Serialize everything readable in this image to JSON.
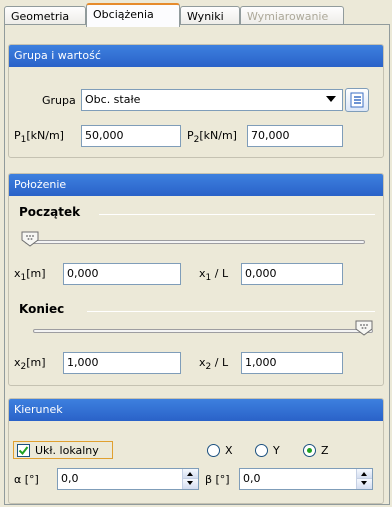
{
  "tabs": [
    {
      "label": "Geometria",
      "state": "normal"
    },
    {
      "label": "Obciążenia",
      "state": "active"
    },
    {
      "label": "Wyniki",
      "state": "normal"
    },
    {
      "label": "Wymiarowanie",
      "state": "disabled"
    }
  ],
  "group_value": {
    "header": "Grupa i wartość",
    "group_label": "Grupa",
    "group_selected": "Obc. stałe",
    "p1_label_main": "P",
    "p1_label_sub": "1",
    "p1_label_unit": "[kN/m]",
    "p1_value": "50,000",
    "p2_label_main": "P",
    "p2_label_sub": "2",
    "p2_label_unit": "[kN/m]",
    "p2_value": "70,000"
  },
  "position": {
    "header": "Położenie",
    "start_title": "Początek",
    "start_slider_fraction": 0.0,
    "x1_label_main": "x",
    "x1_label_sub": "1",
    "x1_label_unit": "[m]",
    "x1_value": "0,000",
    "x1L_label_main": "x",
    "x1L_label_sub": "1",
    "x1L_label_unit": "/ L",
    "x1L_value": "0,000",
    "end_title": "Koniec",
    "end_slider_fraction": 1.0,
    "x2_label_main": "x",
    "x2_label_sub": "2",
    "x2_label_unit": "[m]",
    "x2_value": "1,000",
    "x2L_label_main": "x",
    "x2L_label_sub": "2",
    "x2L_label_unit": "/ L",
    "x2L_value": "1,000"
  },
  "direction": {
    "header": "Kierunek",
    "local_checkbox_label": "Ukł. lokalny",
    "local_checked": true,
    "radio_x": "X",
    "radio_y": "Y",
    "radio_z": "Z",
    "selected_axis": "Z",
    "alpha_label": "α [°]",
    "alpha_value": "0,0",
    "beta_label": "β [°]",
    "beta_value": "0,0"
  },
  "colors": {
    "header_blue": "#2a62c8",
    "active_tab_accent": "#e68b2c",
    "check_green": "#21a121"
  }
}
